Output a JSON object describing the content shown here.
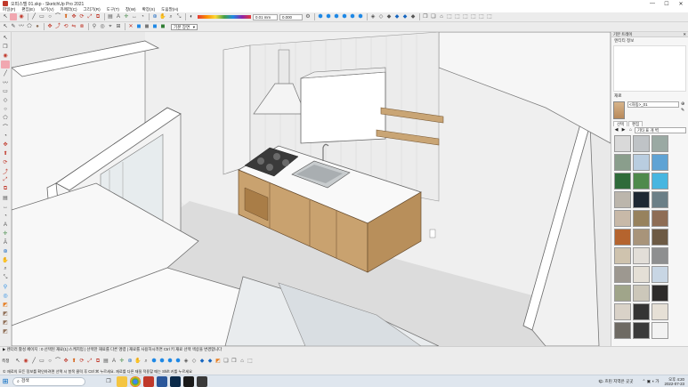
{
  "window": {
    "title": "오피스텔 01.skp - SketchUp Pro 2021",
    "minimize": "—",
    "maximize": "☐",
    "close": "✕"
  },
  "menubar": {
    "items": [
      "파일(F)",
      "편집(E)",
      "보기(V)",
      "카메라(C)",
      "그리기(R)",
      "도구(T)",
      "창(W)",
      "확장(X)",
      "도움말(H)"
    ]
  },
  "toolbar1": {
    "field1": "0.01 mm",
    "field2": "0.000"
  },
  "toolbar2": {
    "scene_label": "씬",
    "scene_value": "기본 장면"
  },
  "tray": {
    "header_title": "기본 트레이",
    "header_close": "✕",
    "section_styles": "엔티티 정보",
    "section_materials": "재료",
    "current_material": "<자동>_01",
    "tab_select": "선택",
    "tab_edit": "편집",
    "library_select": "기타 표 개 벽",
    "swatch_colors": [
      [
        "#d9d9d9",
        "#bfc3c6",
        "#9aa9a3"
      ],
      [
        "#8a9e8c",
        "#b9cde0",
        "#5fa3d4"
      ],
      [
        "#2f6b3a",
        "#4f8a4c",
        "#48b6e0"
      ],
      [
        "#bcb6ac",
        "#1e2833",
        "#6b7f87"
      ],
      [
        "#c8b9a8",
        "#97825e",
        "#8e6d55"
      ],
      [
        "#b5642e",
        "#a8947a",
        "#6d5a44"
      ],
      [
        "#cfc3ae",
        "#e2ded8",
        "#8e8f90"
      ],
      [
        "#9d9890",
        "#e4dfd6",
        "#c8d6e4"
      ],
      [
        "#a0a58a",
        "#ccc7ba",
        "#2d2b2a"
      ],
      [
        "#d9d2c8",
        "#343434",
        "#e6e0d6"
      ],
      [
        "#6e6a63",
        "#3a3a3a",
        "#f2f2f2"
      ]
    ]
  },
  "status": {
    "line1": "▶ 렌더러 활성 페이지 : 0 선택된 재료(1):스케치업 | 선택한 재료를 다른 명령 | 재료를 사용하시려면 Ctrl 키 재료 선택 색상을 변경합니다",
    "measure_label": "측정",
    "hint": "① 재료의 모든 정보를 확인하려면 선택 시 항목 클릭 후 Ctrl ⌘ 누르세요. 재료를 다른 재질 적용할 때는 Shift 키를 누르세요"
  },
  "taskbar": {
    "start": "⊞",
    "search_placeholder": "검색",
    "weather": "🌤 흐린 지역은 곳곳",
    "time": "오후 4:20",
    "date": "2022-07-23"
  }
}
